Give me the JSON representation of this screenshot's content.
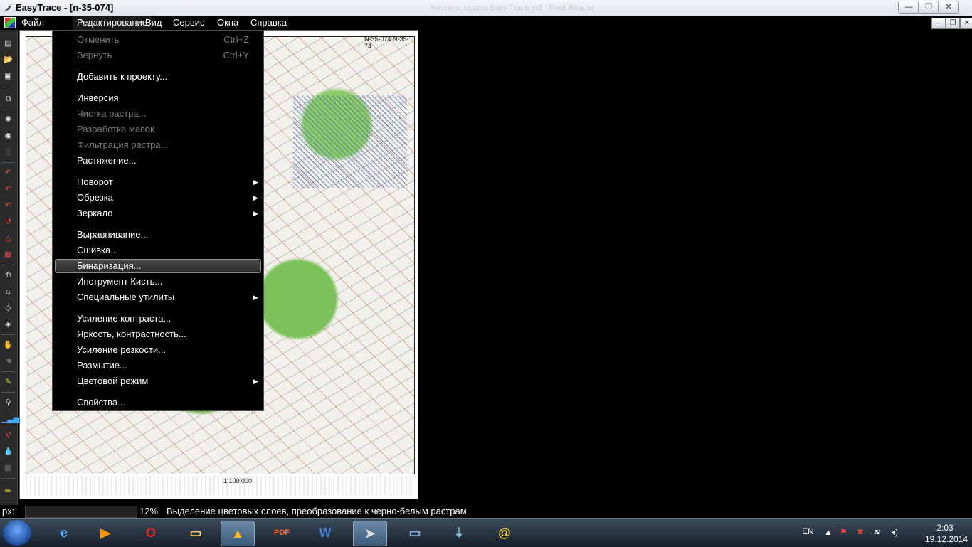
{
  "window": {
    "title": "EasyTrace - [n-35-074]",
    "faint_title": "Частная задача Easy Trace.pdf - Foxit Reader"
  },
  "menubar": {
    "items": [
      "Файл",
      "Редактирование",
      "Вид",
      "Сервис",
      "Окна",
      "Справка"
    ]
  },
  "dropdown": {
    "items": [
      {
        "label": "Отменить",
        "shortcut": "Ctrl+Z",
        "disabled": true
      },
      {
        "label": "Вернуть",
        "shortcut": "Ctrl+Y",
        "disabled": true
      },
      {
        "label": "Добавить к проекту...",
        "disabled": false
      },
      {
        "label": "Инверсия",
        "disabled": false
      },
      {
        "label": "Чистка растра...",
        "disabled": true
      },
      {
        "label": "Разработка масок",
        "disabled": true
      },
      {
        "label": "Фильтрация растра...",
        "disabled": true
      },
      {
        "label": "Растяжение...",
        "disabled": false
      },
      {
        "label": "Поворот",
        "submenu": true
      },
      {
        "label": "Обрезка",
        "submenu": true
      },
      {
        "label": "Зеркало",
        "submenu": true
      },
      {
        "label": "Выравнивание...",
        "disabled": false
      },
      {
        "label": "Сшивка...",
        "disabled": false
      },
      {
        "label": "Бинаризация...",
        "highlighted": true
      },
      {
        "label": "Инструмент Кисть...",
        "disabled": false
      },
      {
        "label": "Специальные утилиты",
        "submenu": true
      },
      {
        "label": "Усиление контраста...",
        "disabled": false
      },
      {
        "label": "Яркость, контрастность...",
        "disabled": false
      },
      {
        "label": "Усиление резкости...",
        "disabled": false
      },
      {
        "label": "Размытие...",
        "disabled": false
      },
      {
        "label": "Цветовой режим",
        "submenu": true
      },
      {
        "label": "Свойства...",
        "disabled": false
      }
    ]
  },
  "map": {
    "sheet_header": "N-35-074  N-35-74",
    "scale": "1:100 000"
  },
  "statusbar": {
    "px_label": "px:",
    "zoom": "12%",
    "message": "Выделение цветовых слоев, преобразование к черно-белым растрам"
  },
  "taskbar": {
    "apps": [
      "internet-explorer",
      "media-player",
      "opera",
      "file-explorer",
      "avast",
      "foxit-pdf",
      "word",
      "easytrace",
      "image-viewer",
      "network-setup",
      "mail-agent"
    ],
    "lang": "EN",
    "time": "2:03",
    "date": "19.12.2014"
  },
  "toolbar_icons": [
    "new-icon",
    "open-icon",
    "save-icon",
    "copy-icon",
    "palette-icon",
    "globe-icon",
    "texture-icon",
    "rotate-90-icon",
    "rotate-180-icon",
    "rotate-270-icon",
    "undo-rotate-icon",
    "triangle-icon",
    "calculator-icon",
    "transform-icon",
    "warp-icon",
    "fit-icon",
    "zoom-icon",
    "hand-icon",
    "hand2-icon",
    "brush-icon",
    "eyedropper-icon",
    "histogram-icon",
    "filter-icon",
    "drop-icon",
    "grid-icon",
    "pencil-icon"
  ]
}
